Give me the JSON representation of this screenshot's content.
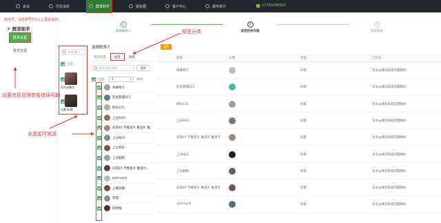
{
  "topbar": {
    "items": [
      {
        "label": "会话",
        "icon": "chat-icon"
      },
      {
        "label": "历史消息",
        "icon": "history-icon"
      },
      {
        "label": "群发助手",
        "icon": "broadcast-icon",
        "active": true
      },
      {
        "label": "朋友圈",
        "icon": "moments-icon"
      },
      {
        "label": "客户中心",
        "icon": "customer-icon"
      },
      {
        "label": "服务统计",
        "icon": "stats-icon"
      }
    ],
    "phone": "13760298803"
  },
  "warning": "到信号，请您养号7天以上再去操作。",
  "sidebar": {
    "title": "群发助手",
    "items": [
      "群发设置",
      "群发管理"
    ]
  },
  "steps": [
    {
      "num": "1",
      "label": "选择联系人"
    },
    {
      "num": "2",
      "label": "设定任务内容"
    },
    {
      "num": "3",
      "label": "预览群发"
    }
  ],
  "contacts": {
    "search_placeholder": "昵称/备注",
    "select_all": "全选",
    "accounts": [
      "东东@微信",
      "杜鹏-私域"
    ]
  },
  "friends": {
    "title": "选择联系人",
    "tabs": [
      "所有好友",
      "标签",
      "群聊"
    ],
    "search_placeholder": "昵称/备注/微信",
    "search_button": "搜索",
    "select_all": "全选",
    "page": "1",
    "total": "共30",
    "list": [
      "尚峰特工",
      "前台管理021",
      "侠份235",
      "上分DXG",
      "异常81 不推名片 推名片 推...",
      "上分NEX",
      "上分晋长",
      "上分酷跑",
      "异常87 不推名片 推名片...",
      "qahrxqnfj",
      "上播总数",
      "完成",
      "软转推"
    ]
  },
  "table": {
    "select_button": "选择",
    "headers": [
      "昵称",
      "头像",
      "类型",
      "工作号"
    ],
    "rows": [
      {
        "nick": "尚峰特工",
        "type": "好友",
        "work": "东东@微信私域流量顾问"
      },
      {
        "nick": "前台管理021",
        "type": "好友",
        "work": "东东@微信私域流量顾问"
      },
      {
        "nick": "侠份235",
        "type": "好友",
        "work": "东东@微信私域流量顾问"
      },
      {
        "nick": "上分DXG",
        "type": "好友",
        "work": "东东@微信私域流量顾问"
      },
      {
        "nick": "异常87 不推名片 推名片 推演子",
        "type": "好友",
        "work": "东东@微信私域流量顾问"
      },
      {
        "nick": "上分NEX",
        "type": "好友",
        "work": "东东@微信私域流量顾问"
      },
      {
        "nick": "上分酷跑",
        "type": "好友",
        "work": "东东@微信私域流量顾问"
      },
      {
        "nick": "异常87 不推名片 推名片 推演子",
        "type": "好友",
        "work": "东东@微信私域流量顾问"
      },
      {
        "nick": "qahrxqnfj",
        "type": "好友",
        "work": "东东@微信私域流量顾问"
      }
    ]
  },
  "annotations": {
    "tag_category": "标签分类",
    "setup_note": "设置完后管理查看错误可删",
    "select_all_note": "全选定时发送"
  }
}
